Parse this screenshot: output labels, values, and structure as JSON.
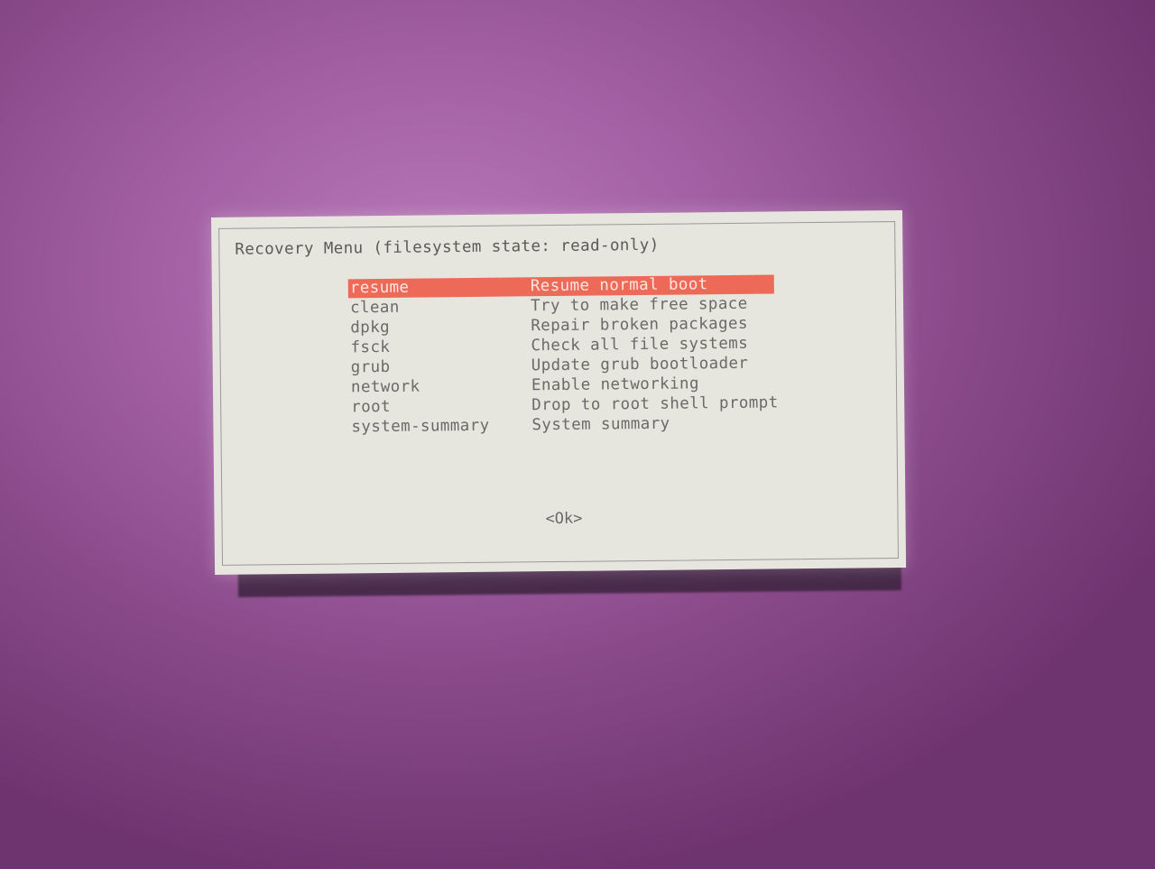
{
  "dialog": {
    "title": "Recovery Menu (filesystem state: read-only)",
    "items": [
      {
        "key": "resume",
        "description": "Resume normal boot",
        "selected": true
      },
      {
        "key": "clean",
        "description": "Try to make free space"
      },
      {
        "key": "dpkg",
        "description": "Repair broken packages"
      },
      {
        "key": "fsck",
        "description": "Check all file systems"
      },
      {
        "key": "grub",
        "description": "Update grub bootloader"
      },
      {
        "key": "network",
        "description": "Enable networking"
      },
      {
        "key": "root",
        "description": "Drop to root shell prompt"
      },
      {
        "key": "system-summary",
        "description": "System summary"
      }
    ],
    "ok_label": "<Ok>"
  },
  "colors": {
    "highlight": "#ee6a58",
    "dialog_bg": "#e6e6df",
    "background": "#a361a4"
  }
}
